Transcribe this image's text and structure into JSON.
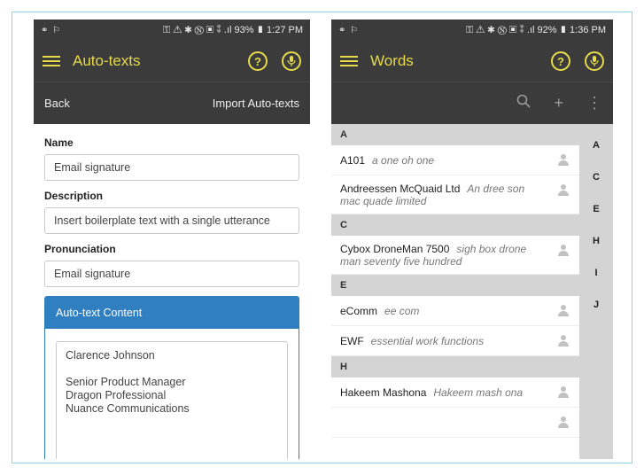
{
  "left": {
    "status": {
      "icons": "⚭ ⚐",
      "right": "⚿ ⚠ ✱ Ⓝ ▣ ⁑ .ıl 93% ▮ 1:27 PM"
    },
    "appbar": {
      "title": "Auto-texts",
      "help_icon": "?",
      "mic_icon": "🎙"
    },
    "subbar": {
      "back": "Back",
      "import": "Import Auto-texts"
    },
    "form": {
      "name_label": "Name",
      "name_value": "Email signature",
      "description_label": "Description",
      "description_value": "Insert boilerplate text with a single utterance",
      "pronunciation_label": "Pronunciation",
      "pronunciation_value": "Email signature"
    },
    "content_panel": {
      "title": "Auto-text Content",
      "lines": [
        "Clarence Johnson",
        "",
        "Senior Product Manager",
        "Dragon Professional",
        "Nuance Communications"
      ]
    }
  },
  "right": {
    "status": {
      "icons": "⚭ ⚐",
      "right": "⚿ ⚠ ✱ Ⓝ ▣ ⁑ .ıl 92% ▮ 1:36 PM"
    },
    "appbar": {
      "title": "Words",
      "help_icon": "?",
      "mic_icon": "🎙"
    },
    "toolbar": {
      "search_icon": "🔍",
      "add_icon": "+",
      "more_icon": "⋮"
    },
    "sections": [
      {
        "letter": "A",
        "rows": [
          {
            "word": "A101",
            "pron": "a one oh one",
            "line2": ""
          },
          {
            "word": "Andreessen McQuaid Ltd",
            "pron": "An dree son",
            "line2": "mac quade limited"
          }
        ]
      },
      {
        "letter": "C",
        "rows": [
          {
            "word": "Cybox DroneMan 7500",
            "pron": "sigh box drone",
            "line2": "man seventy five hundred"
          }
        ]
      },
      {
        "letter": "E",
        "rows": [
          {
            "word": "eComm",
            "pron": "ee com",
            "line2": ""
          },
          {
            "word": "EWF",
            "pron": "essential work functions",
            "line2": ""
          }
        ]
      },
      {
        "letter": "H",
        "rows": [
          {
            "word": "Hakeem Mashona",
            "pron": "Hakeem mash ona",
            "line2": ""
          }
        ]
      }
    ],
    "index_letters": [
      "A",
      "C",
      "E",
      "H",
      "I",
      "J"
    ]
  }
}
